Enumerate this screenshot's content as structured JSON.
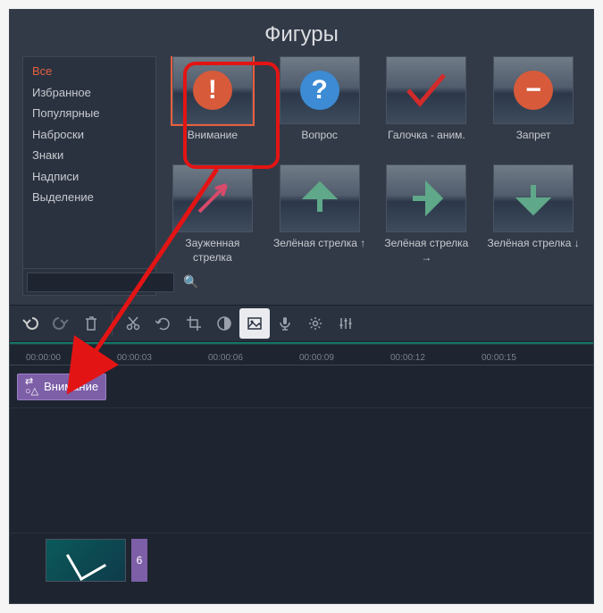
{
  "library": {
    "title": "Фигуры",
    "categories": [
      {
        "label": "Все",
        "active": true
      },
      {
        "label": "Избранное",
        "active": false
      },
      {
        "label": "Популярные",
        "active": false
      },
      {
        "label": "Наброски",
        "active": false
      },
      {
        "label": "Знаки",
        "active": false
      },
      {
        "label": "Надписи",
        "active": false
      },
      {
        "label": "Выделение",
        "active": false
      }
    ],
    "search": {
      "placeholder": "",
      "value": ""
    },
    "shapes": [
      {
        "label": "Внимание",
        "icon": "exclaim",
        "selected": true
      },
      {
        "label": "Вопрос",
        "icon": "question",
        "selected": false
      },
      {
        "label": "Галочка - аним.",
        "icon": "check-red",
        "selected": false
      },
      {
        "label": "Запрет",
        "icon": "minus",
        "selected": false
      },
      {
        "label": "Зауженная стрелка",
        "icon": "thin-arrow",
        "selected": false
      },
      {
        "label": "Зелёная стрелка ↑",
        "icon": "arrow-up",
        "selected": false
      },
      {
        "label": "Зелёная стрелка →",
        "icon": "arrow-right",
        "selected": false
      },
      {
        "label": "Зелёная стрелка ↓",
        "icon": "arrow-down",
        "selected": false
      }
    ]
  },
  "toolbar": {
    "undo": "↶",
    "redo": "↷",
    "trash": "🗑",
    "cut": "✂",
    "rotate": "⟳",
    "crop": "◫",
    "contrast": "◐",
    "image": "🖼",
    "mic": "🎤",
    "gear": "⚙",
    "sliders": "⫼"
  },
  "timeline": {
    "ticks": [
      "00:00:00",
      "00:00:03",
      "00:00:06",
      "00:00:09",
      "00:00:12",
      "00:00:15"
    ],
    "clip": {
      "label": "Внимание"
    },
    "media_tag": "6"
  }
}
